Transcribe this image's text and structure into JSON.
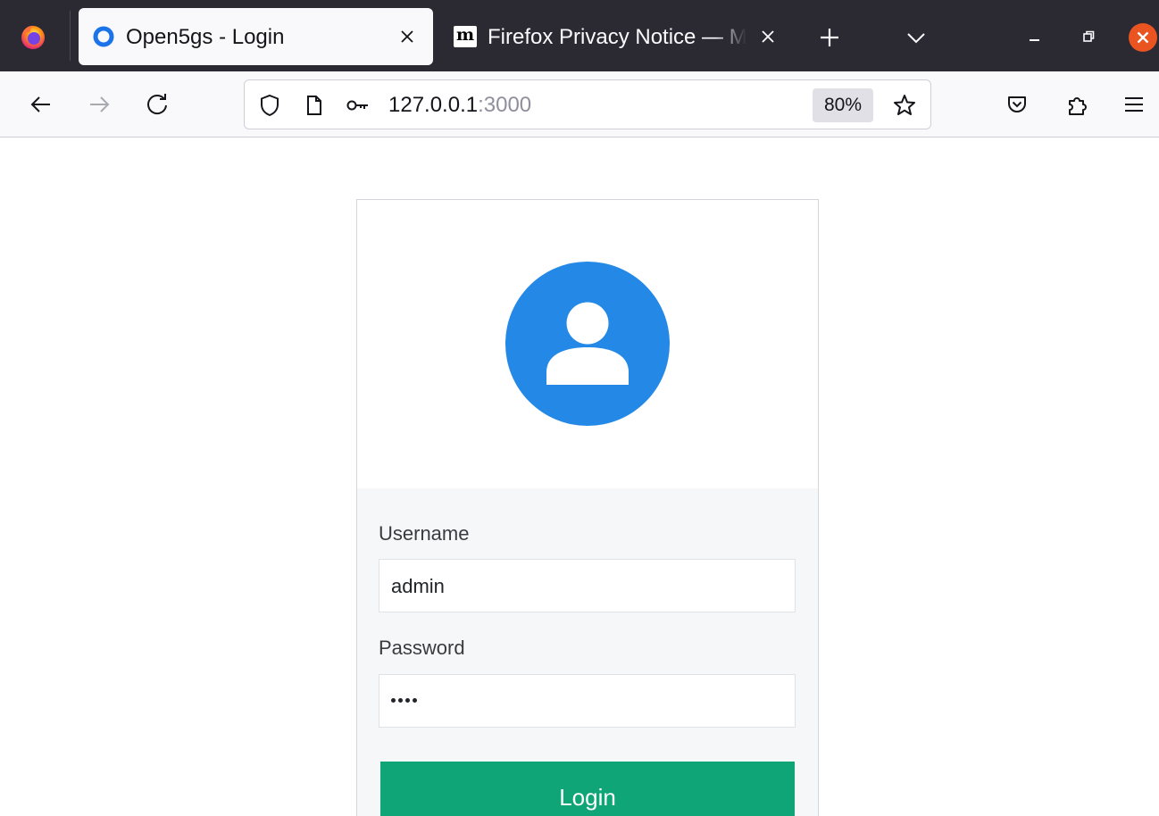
{
  "browser": {
    "tabs": [
      {
        "title": "Open5gs - Login",
        "active": true
      },
      {
        "title": "Firefox Privacy Notice — Mozilla",
        "active": false,
        "favicon_letter": "m"
      }
    ],
    "url": {
      "host": "127.0.0.1",
      "port": ":3000"
    },
    "zoom": "80%",
    "icons": {
      "app": "firefox-logo-icon",
      "back": "arrow-left-icon",
      "forward": "arrow-right-icon",
      "reload": "reload-icon",
      "tracking_protection": "shield-icon",
      "page_info": "page-icon",
      "permissions": "key-icon",
      "bookmark": "star-icon",
      "pocket": "pocket-icon",
      "extensions": "puzzle-icon",
      "menu": "hamburger-menu-icon"
    },
    "colors": {
      "tabstrip": "#2b2a33",
      "toolbar": "#f9f9fb",
      "window_close": "#e95420"
    }
  },
  "page": {
    "login": {
      "avatar_icon": "user-avatar-icon",
      "username_label": "Username",
      "username_value": "admin",
      "password_label": "Password",
      "password_value": "••••",
      "password_length": 4,
      "submit_label": "Login"
    },
    "colors": {
      "avatar": "#2388e6",
      "login_button": "#0fa576"
    }
  }
}
